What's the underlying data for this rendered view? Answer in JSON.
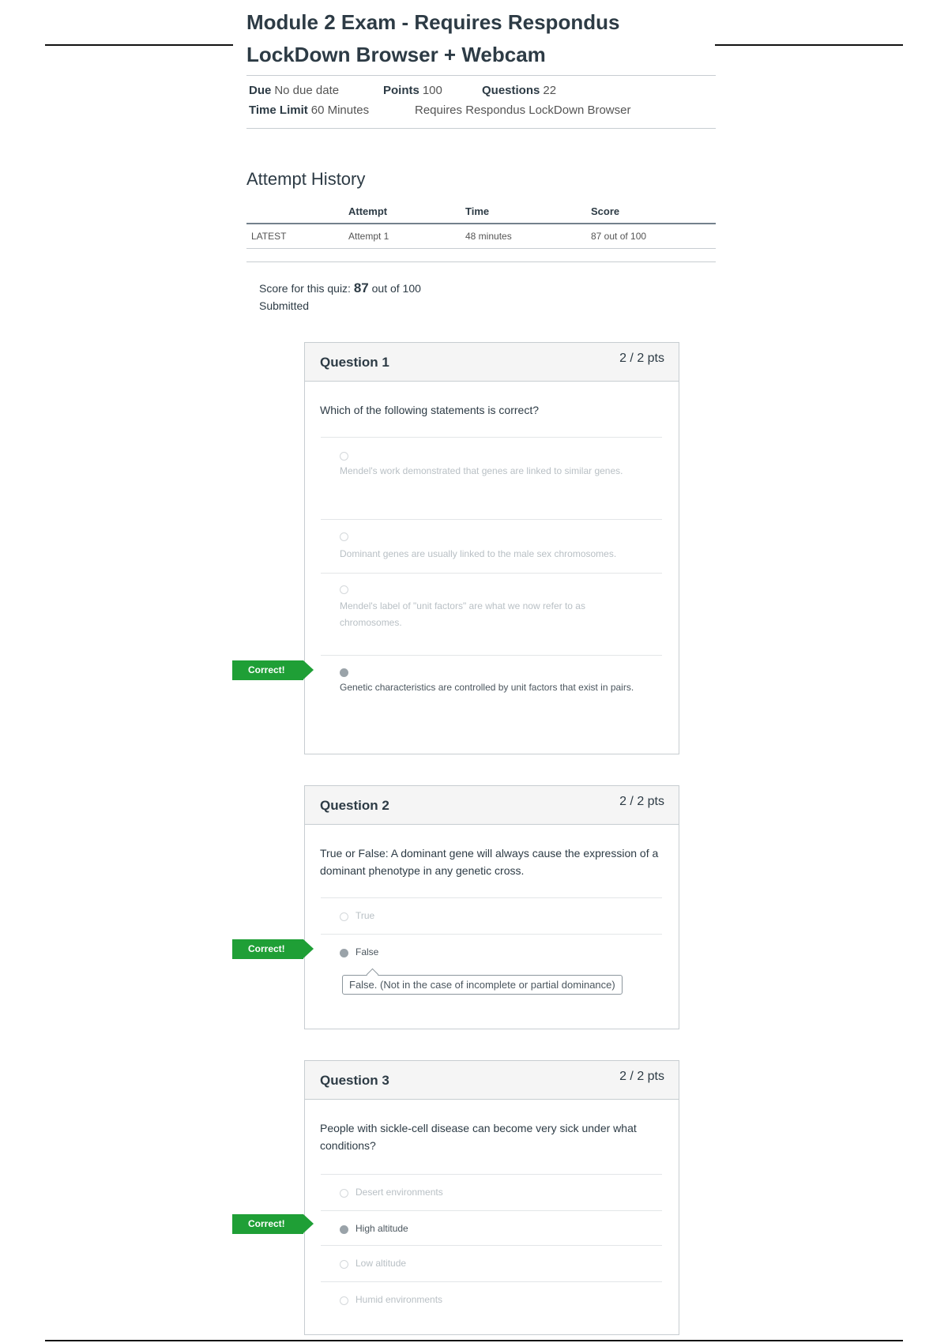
{
  "exam": {
    "title": "Module 2 Exam - Requires Respondus LockDown Browser + Webcam",
    "due_label": "Due",
    "due_value": "No due date",
    "points_label": "Points",
    "points_value": "100",
    "questions_label": "Questions",
    "questions_value": "22",
    "time_limit_label": "Time Limit",
    "time_limit_value": "60 Minutes",
    "lockdown_note": "Requires Respondus LockDown Browser"
  },
  "attempt_history": {
    "heading": "Attempt History",
    "columns": [
      "Attempt",
      "Time",
      "Score"
    ],
    "rows": [
      {
        "tag": "LATEST",
        "attempt": "Attempt 1",
        "time": "48 minutes",
        "score": "87 out of 100"
      }
    ]
  },
  "summary": {
    "score_prefix": "Score for this quiz:",
    "score_value": "87",
    "score_suffix": "out of 100",
    "status": "Submitted"
  },
  "questions": [
    {
      "title": "Question 1",
      "points": "2 / 2 pts",
      "text": "Which of the following statements is correct?",
      "answers": [
        {
          "text": "Mendel's work demonstrated that genes are linked to similar genes.",
          "selected": false
        },
        {
          "text": "Dominant genes are usually linked to the male sex chromosomes.",
          "selected": false
        },
        {
          "text": "Mendel's label of \"unit factors\" are what we now refer to as chromosomes.",
          "selected": false
        },
        {
          "text": "Genetic characteristics are controlled by unit factors that exist in pairs.",
          "selected": true
        }
      ],
      "flag": "Correct!"
    },
    {
      "title": "Question 2",
      "points": "2 / 2 pts",
      "text": "True or False: A dominant gene will always cause the expression of a dominant phenotype in any genetic cross.",
      "answers": [
        {
          "text": "True",
          "selected": false
        },
        {
          "text": "False",
          "selected": true
        }
      ],
      "flag": "Correct!",
      "comment": "False. (Not in the case of incomplete or partial dominance)"
    },
    {
      "title": "Question 3",
      "points": "2 / 2 pts",
      "text": "People with sickle-cell disease can become very sick under what conditions?",
      "answers": [
        {
          "text": "Desert environments",
          "selected": false
        },
        {
          "text": "High altitude",
          "selected": true
        },
        {
          "text": "Low altitude",
          "selected": false
        },
        {
          "text": "Humid environments",
          "selected": false
        }
      ],
      "flag": "Correct!"
    }
  ],
  "colors": {
    "correct_green": "#1f9f36",
    "link_blue": "#2a7bbd",
    "header_gray": "#f5f5f5"
  }
}
